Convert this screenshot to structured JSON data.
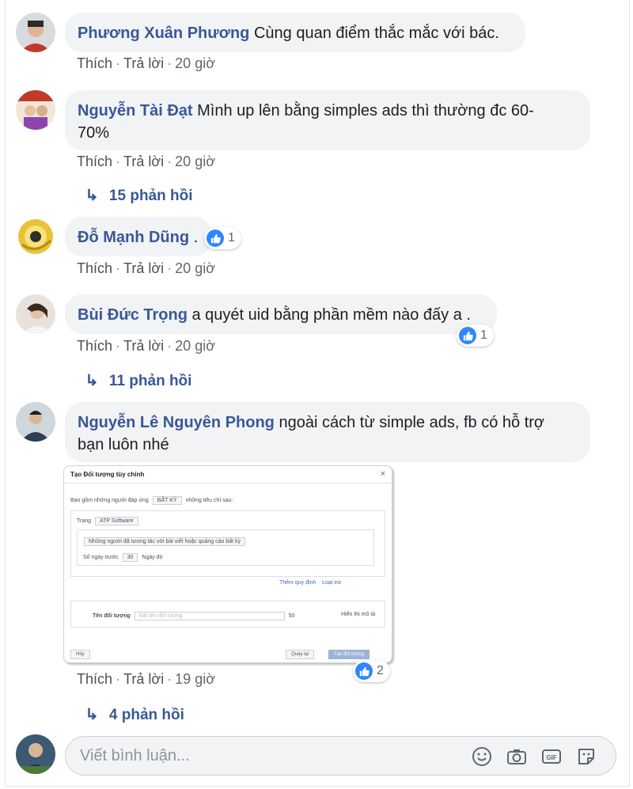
{
  "comments": [
    {
      "author": "Phương Xuân Phương",
      "text": "Cùng quan điểm thắc mắc với bác.",
      "actions": {
        "like": "Thích",
        "reply": "Trả lời",
        "time": "20 giờ"
      }
    },
    {
      "author": "Nguyễn Tài Đạt",
      "text_line1": "Mình up lên bằng simples ads thì thường đc 60-",
      "text_line2": "70%",
      "actions": {
        "like": "Thích",
        "reply": "Trả lời",
        "time": "20 giờ"
      },
      "replies": "15 phản hồi"
    },
    {
      "author": "Đỗ Mạnh Dũng",
      "text": ".",
      "likes": "1",
      "actions": {
        "like": "Thích",
        "reply": "Trả lời",
        "time": "20 giờ"
      }
    },
    {
      "author": "Bùi Đức Trọng",
      "text": "a quyét uid bằng phần mềm nào đấy a .",
      "likes": "1",
      "actions": {
        "like": "Thích",
        "reply": "Trả lời",
        "time": "20 giờ"
      },
      "replies": "11 phản hồi"
    },
    {
      "author": "Nguyễn Lê Nguyên Phong",
      "text_line1": "ngoài cách từ simple ads, fb có hỗ trợ",
      "text_line2": "bạn luôn nhé",
      "likes": "2",
      "actions": {
        "like": "Thích",
        "reply": "Trả lời",
        "time": "19 giờ"
      },
      "replies": "4 phản hồi"
    }
  ],
  "attachment": {
    "title": "Tạo Đối tượng tùy chỉnh",
    "close": "×",
    "row1_label": "Bao gồm những người đáp ứng",
    "row1_select": "BẤT KỲ",
    "row1_suffix": "những tiêu chí sau:",
    "page_label": "Trang",
    "page_select": "ATP Software",
    "rule_select": "Những người đã tương tác với bài viết hoặc quảng cáo bất kỳ",
    "days_label": "Số ngày trước",
    "days_value": "30",
    "days_suffix": "Ngày đó",
    "link_exclude": "Thêm quy định",
    "link_exclude2": "Loại trừ",
    "name_label": "Tên đối tượng",
    "name_placeholder": "Đặt tên đối tượng",
    "name_count": "50",
    "desc_link": "Hiển thị mô tả",
    "cancel": "Hủy",
    "back": "Quay lại",
    "create": "Tạo đối tượng"
  },
  "composer": {
    "placeholder": "Viết bình luận..."
  },
  "colors": {
    "author": "#385898",
    "bubble": "#f2f3f5",
    "like_blue": "#2d88ff"
  },
  "icons": [
    "emoji-icon",
    "camera-icon",
    "gif-icon",
    "sticker-icon",
    "reply-arrow-icon",
    "like-icon"
  ]
}
